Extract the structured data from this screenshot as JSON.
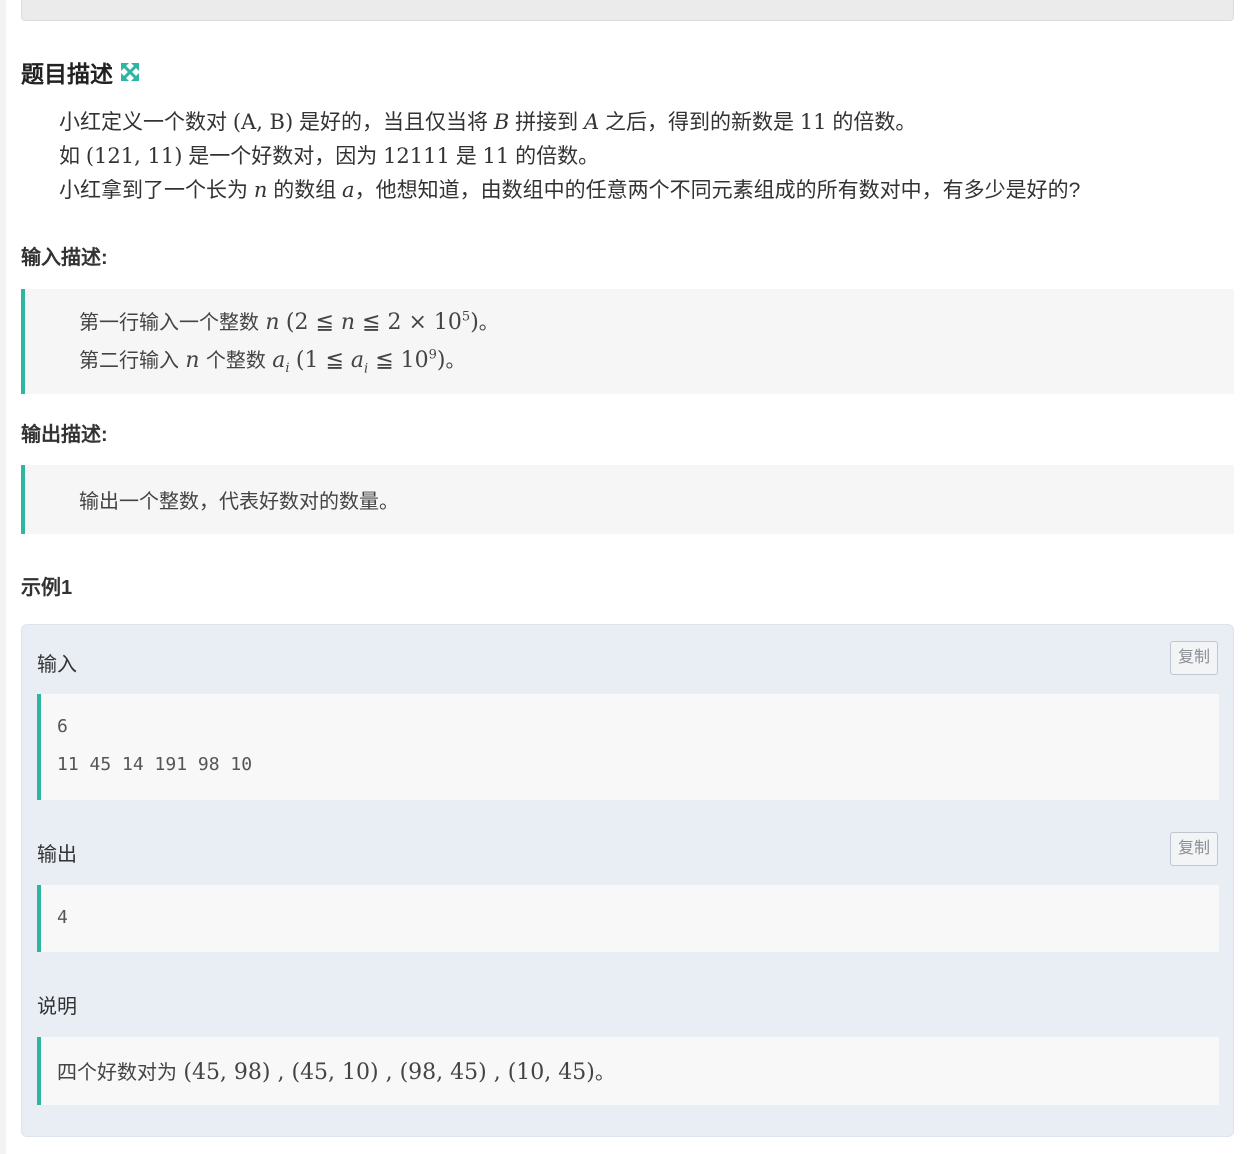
{
  "problem": {
    "title": "题目描述",
    "expand_icon": "expand-arrows-icon",
    "description": {
      "line1": {
        "t1": "小红定义一个数对 ",
        "m1": "(A, B)",
        "t2": " 是好的，当且仅当将 ",
        "m2": "B",
        "t3": " 拼接到 ",
        "m3": "A",
        "t4": " 之后，得到的新数是 ",
        "m4": "11",
        "t5": " 的倍数。"
      },
      "line2": {
        "t1": "如 ",
        "m1": "(121, 11)",
        "t2": " 是一个好数对，因为 ",
        "m2": "12111",
        "t3": " 是 ",
        "m3": "11",
        "t4": " 的倍数。"
      },
      "line3": {
        "t1": "小红拿到了一个长为 ",
        "m1": "n",
        "t2": " 的数组 ",
        "m2": "a",
        "t3": "，他想知道，由数组中的任意两个不同元素组成的所有数对中，有多少是好的?"
      }
    }
  },
  "input_section": {
    "title": "输入描述:",
    "line1": {
      "text": "第一行输入一个整数 ",
      "var": "n",
      "constraint_open": "(2 ≦ ",
      "constraint_var": "n",
      "constraint_mid": " ≦ 2 × 10",
      "exp": "5",
      "constraint_close": ")",
      "end": "。"
    },
    "line2": {
      "text": "第二行输入 ",
      "var": "n",
      "text2": " 个整数 ",
      "var2": "a",
      "sub": "i",
      "constraint_open": "(1 ≦ ",
      "constraint_var": "a",
      "constraint_sub": "i",
      "constraint_mid": " ≦ 10",
      "exp": "9",
      "constraint_close": ")",
      "end": "。"
    }
  },
  "output_section": {
    "title": "输出描述:",
    "line1": "输出一个整数，代表好数对的数量。"
  },
  "example": {
    "title": "示例1",
    "input_label": "输入",
    "output_label": "输出",
    "copy_label": "复制",
    "input_lines": [
      "6",
      "11 45 14 191 98 10"
    ],
    "output_lines": [
      "4"
    ],
    "explain_label": "说明",
    "explain_text": "四个好数对为 ",
    "explain_math": "(45, 98) , (45, 10) , (98, 45) , (10, 45)",
    "explain_end": "。"
  },
  "colors": {
    "accent": "#2eb6a3",
    "example_bg": "#e9eef5",
    "quote_bg": "#f6f6f7"
  }
}
